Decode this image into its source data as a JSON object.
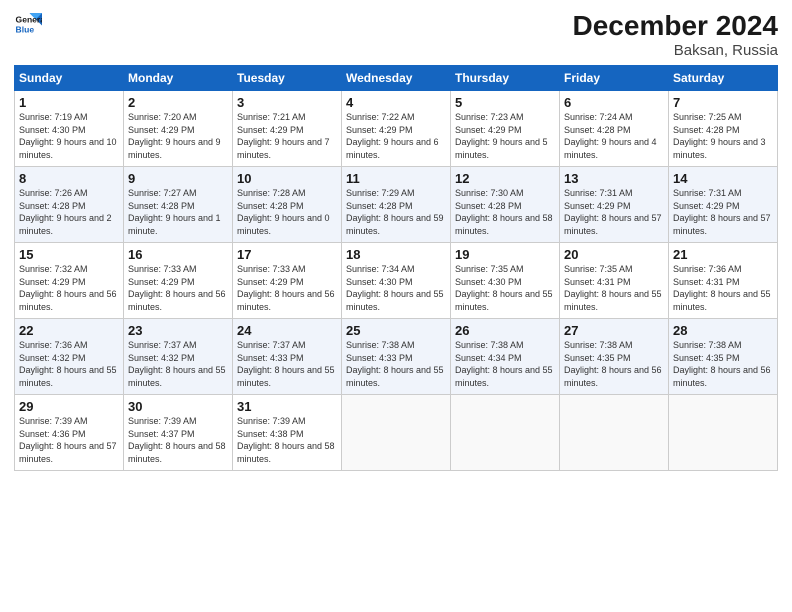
{
  "header": {
    "logo_line1": "General",
    "logo_line2": "Blue",
    "title": "December 2024",
    "subtitle": "Baksan, Russia"
  },
  "weekdays": [
    "Sunday",
    "Monday",
    "Tuesday",
    "Wednesday",
    "Thursday",
    "Friday",
    "Saturday"
  ],
  "weeks": [
    [
      {
        "day": "1",
        "sunrise": "Sunrise: 7:19 AM",
        "sunset": "Sunset: 4:30 PM",
        "daylight": "Daylight: 9 hours and 10 minutes."
      },
      {
        "day": "2",
        "sunrise": "Sunrise: 7:20 AM",
        "sunset": "Sunset: 4:29 PM",
        "daylight": "Daylight: 9 hours and 9 minutes."
      },
      {
        "day": "3",
        "sunrise": "Sunrise: 7:21 AM",
        "sunset": "Sunset: 4:29 PM",
        "daylight": "Daylight: 9 hours and 7 minutes."
      },
      {
        "day": "4",
        "sunrise": "Sunrise: 7:22 AM",
        "sunset": "Sunset: 4:29 PM",
        "daylight": "Daylight: 9 hours and 6 minutes."
      },
      {
        "day": "5",
        "sunrise": "Sunrise: 7:23 AM",
        "sunset": "Sunset: 4:29 PM",
        "daylight": "Daylight: 9 hours and 5 minutes."
      },
      {
        "day": "6",
        "sunrise": "Sunrise: 7:24 AM",
        "sunset": "Sunset: 4:28 PM",
        "daylight": "Daylight: 9 hours and 4 minutes."
      },
      {
        "day": "7",
        "sunrise": "Sunrise: 7:25 AM",
        "sunset": "Sunset: 4:28 PM",
        "daylight": "Daylight: 9 hours and 3 minutes."
      }
    ],
    [
      {
        "day": "8",
        "sunrise": "Sunrise: 7:26 AM",
        "sunset": "Sunset: 4:28 PM",
        "daylight": "Daylight: 9 hours and 2 minutes."
      },
      {
        "day": "9",
        "sunrise": "Sunrise: 7:27 AM",
        "sunset": "Sunset: 4:28 PM",
        "daylight": "Daylight: 9 hours and 1 minute."
      },
      {
        "day": "10",
        "sunrise": "Sunrise: 7:28 AM",
        "sunset": "Sunset: 4:28 PM",
        "daylight": "Daylight: 9 hours and 0 minutes."
      },
      {
        "day": "11",
        "sunrise": "Sunrise: 7:29 AM",
        "sunset": "Sunset: 4:28 PM",
        "daylight": "Daylight: 8 hours and 59 minutes."
      },
      {
        "day": "12",
        "sunrise": "Sunrise: 7:30 AM",
        "sunset": "Sunset: 4:28 PM",
        "daylight": "Daylight: 8 hours and 58 minutes."
      },
      {
        "day": "13",
        "sunrise": "Sunrise: 7:31 AM",
        "sunset": "Sunset: 4:29 PM",
        "daylight": "Daylight: 8 hours and 57 minutes."
      },
      {
        "day": "14",
        "sunrise": "Sunrise: 7:31 AM",
        "sunset": "Sunset: 4:29 PM",
        "daylight": "Daylight: 8 hours and 57 minutes."
      }
    ],
    [
      {
        "day": "15",
        "sunrise": "Sunrise: 7:32 AM",
        "sunset": "Sunset: 4:29 PM",
        "daylight": "Daylight: 8 hours and 56 minutes."
      },
      {
        "day": "16",
        "sunrise": "Sunrise: 7:33 AM",
        "sunset": "Sunset: 4:29 PM",
        "daylight": "Daylight: 8 hours and 56 minutes."
      },
      {
        "day": "17",
        "sunrise": "Sunrise: 7:33 AM",
        "sunset": "Sunset: 4:29 PM",
        "daylight": "Daylight: 8 hours and 56 minutes."
      },
      {
        "day": "18",
        "sunrise": "Sunrise: 7:34 AM",
        "sunset": "Sunset: 4:30 PM",
        "daylight": "Daylight: 8 hours and 55 minutes."
      },
      {
        "day": "19",
        "sunrise": "Sunrise: 7:35 AM",
        "sunset": "Sunset: 4:30 PM",
        "daylight": "Daylight: 8 hours and 55 minutes."
      },
      {
        "day": "20",
        "sunrise": "Sunrise: 7:35 AM",
        "sunset": "Sunset: 4:31 PM",
        "daylight": "Daylight: 8 hours and 55 minutes."
      },
      {
        "day": "21",
        "sunrise": "Sunrise: 7:36 AM",
        "sunset": "Sunset: 4:31 PM",
        "daylight": "Daylight: 8 hours and 55 minutes."
      }
    ],
    [
      {
        "day": "22",
        "sunrise": "Sunrise: 7:36 AM",
        "sunset": "Sunset: 4:32 PM",
        "daylight": "Daylight: 8 hours and 55 minutes."
      },
      {
        "day": "23",
        "sunrise": "Sunrise: 7:37 AM",
        "sunset": "Sunset: 4:32 PM",
        "daylight": "Daylight: 8 hours and 55 minutes."
      },
      {
        "day": "24",
        "sunrise": "Sunrise: 7:37 AM",
        "sunset": "Sunset: 4:33 PM",
        "daylight": "Daylight: 8 hours and 55 minutes."
      },
      {
        "day": "25",
        "sunrise": "Sunrise: 7:38 AM",
        "sunset": "Sunset: 4:33 PM",
        "daylight": "Daylight: 8 hours and 55 minutes."
      },
      {
        "day": "26",
        "sunrise": "Sunrise: 7:38 AM",
        "sunset": "Sunset: 4:34 PM",
        "daylight": "Daylight: 8 hours and 55 minutes."
      },
      {
        "day": "27",
        "sunrise": "Sunrise: 7:38 AM",
        "sunset": "Sunset: 4:35 PM",
        "daylight": "Daylight: 8 hours and 56 minutes."
      },
      {
        "day": "28",
        "sunrise": "Sunrise: 7:38 AM",
        "sunset": "Sunset: 4:35 PM",
        "daylight": "Daylight: 8 hours and 56 minutes."
      }
    ],
    [
      {
        "day": "29",
        "sunrise": "Sunrise: 7:39 AM",
        "sunset": "Sunset: 4:36 PM",
        "daylight": "Daylight: 8 hours and 57 minutes."
      },
      {
        "day": "30",
        "sunrise": "Sunrise: 7:39 AM",
        "sunset": "Sunset: 4:37 PM",
        "daylight": "Daylight: 8 hours and 58 minutes."
      },
      {
        "day": "31",
        "sunrise": "Sunrise: 7:39 AM",
        "sunset": "Sunset: 4:38 PM",
        "daylight": "Daylight: 8 hours and 58 minutes."
      },
      null,
      null,
      null,
      null
    ]
  ]
}
